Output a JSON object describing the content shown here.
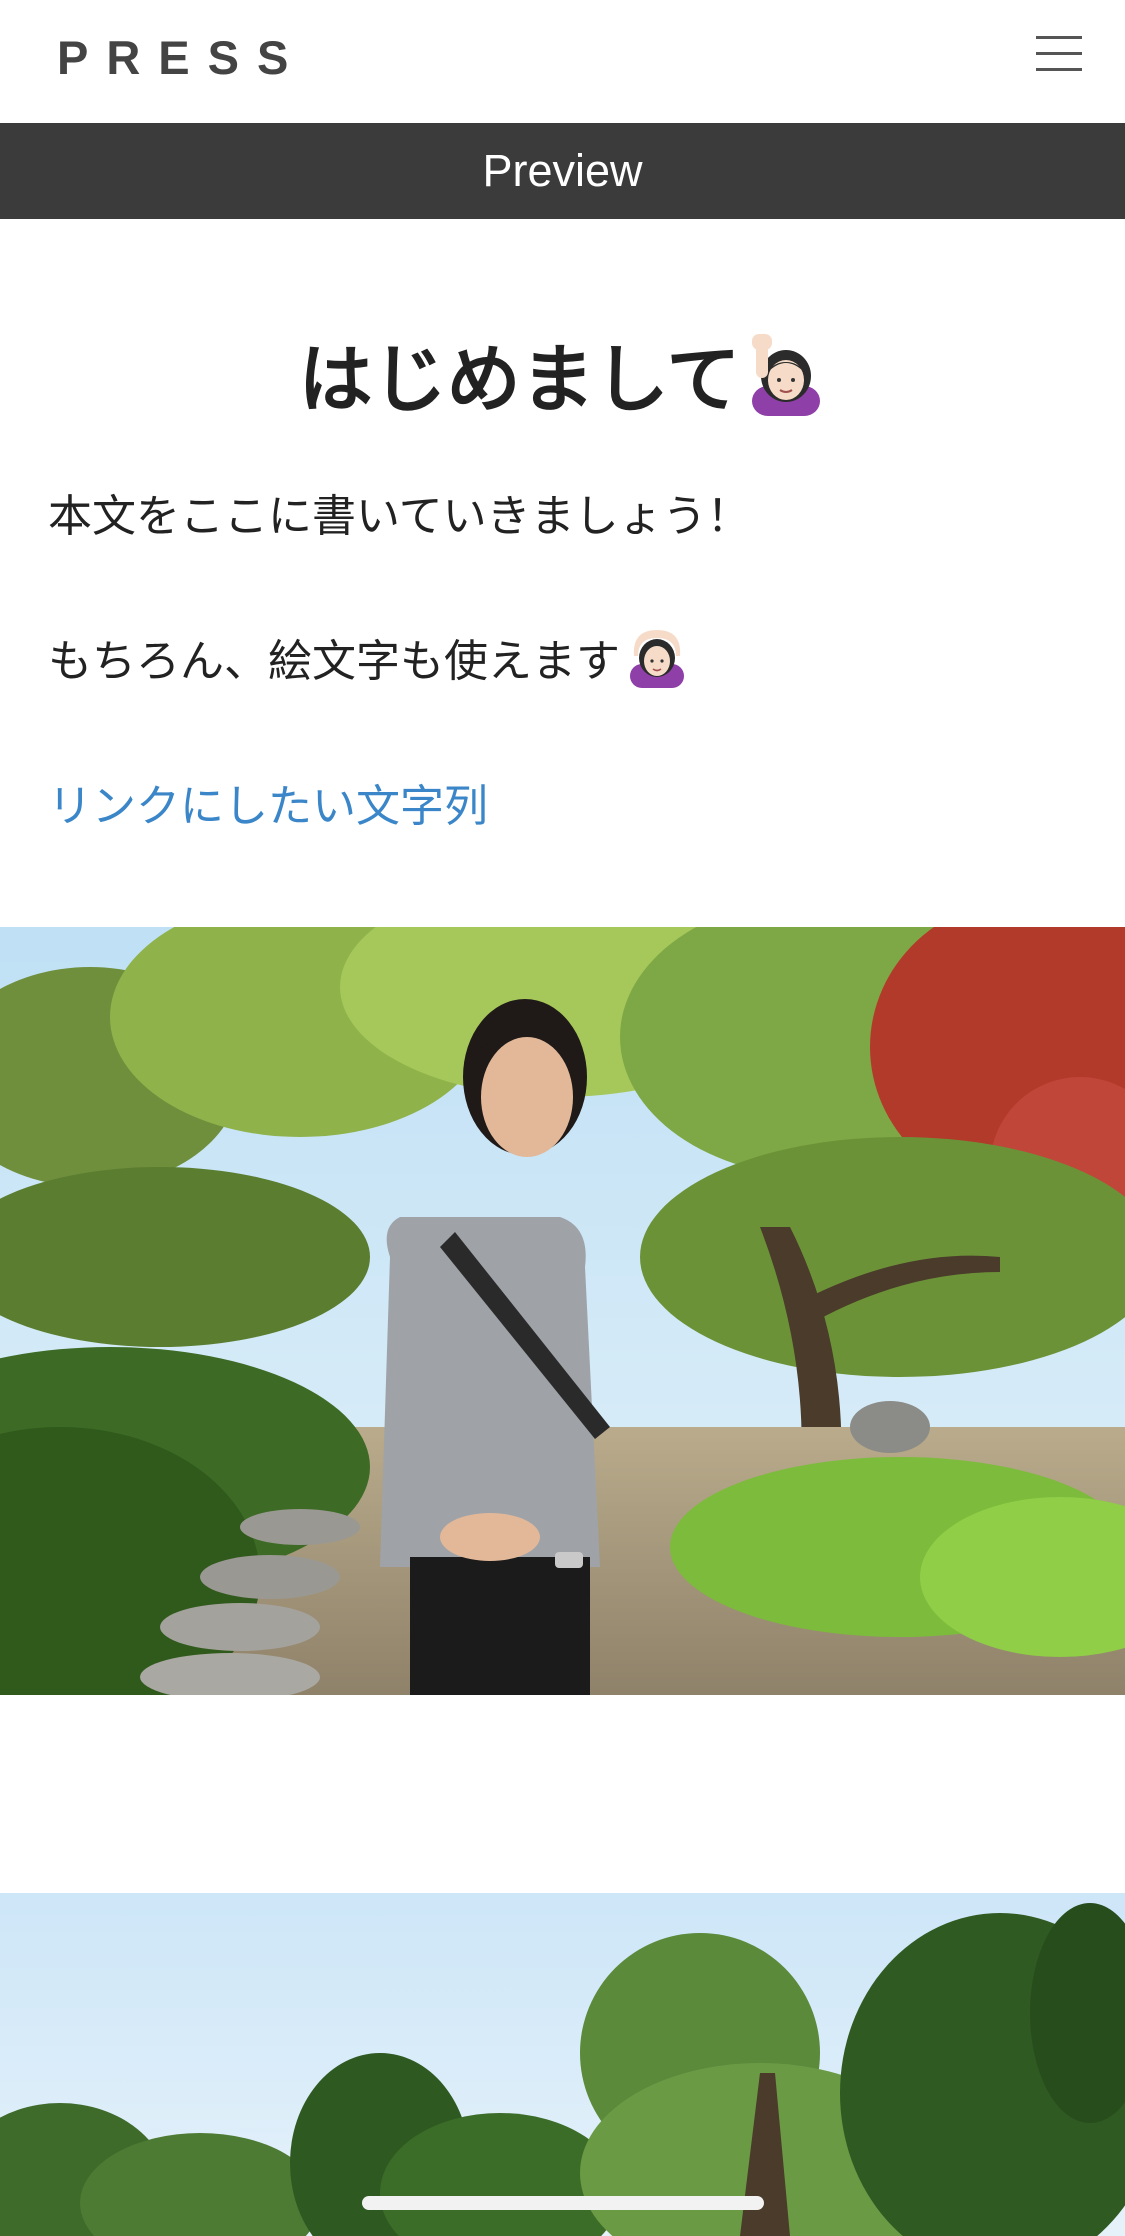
{
  "header": {
    "logo": "PRESS",
    "menu_icon": "hamburger-menu-icon"
  },
  "preview_bar": {
    "label": "Preview"
  },
  "article": {
    "title": "はじめまして",
    "title_emoji": "raising-hand-woman-emoji",
    "paragraph_1": "本文をここに書いていきましょう！",
    "paragraph_2": "もちろん、絵文字も使えます",
    "paragraph_2_emoji": "ok-gesture-woman-emoji",
    "link_text": "リンクにしたい文字列"
  },
  "images": {
    "photo_1": "person-in-japanese-garden-photo",
    "photo_2": "garden-trees-sky-photo"
  },
  "colors": {
    "preview_bar": "#3b3b3b",
    "link": "#3a86c8",
    "text": "#222222"
  }
}
